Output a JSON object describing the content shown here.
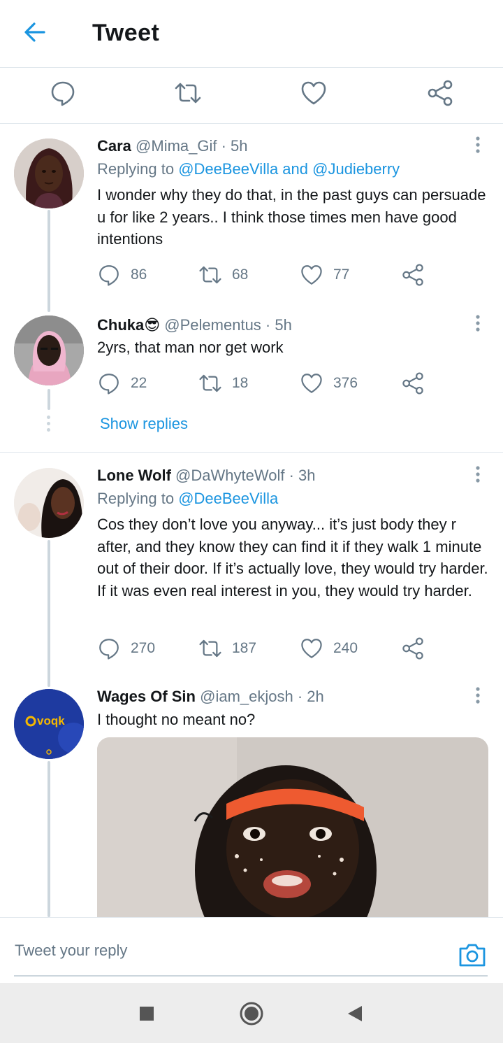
{
  "header": {
    "title": "Tweet"
  },
  "reply_bar": {
    "placeholder": "Tweet your reply"
  },
  "tweets": [
    {
      "name": "Cara",
      "meta": "@Mima_Gif · 5h",
      "replying_prefix": "Replying to ",
      "replying_mentions": "@DeeBeeVilla and @Judieberry",
      "text": "I wonder why they do that, in the past guys can persuade u for like 2 years.. I think those times men have good intentions",
      "replies": "86",
      "retweets": "68",
      "likes": "77"
    },
    {
      "name": "Chuka😎",
      "meta": "@Pelementus · 5h",
      "text": "2yrs, that man nor get work",
      "replies": "22",
      "retweets": "18",
      "likes": "376"
    },
    {
      "name": "Lone Wolf",
      "meta": "@DaWhyteWolf · 3h",
      "replying_prefix": "Replying to ",
      "replying_mentions": "@DeeBeeVilla",
      "text": "Cos they don’t love you anyway... it’s just body they r after, and they know they can find it if they walk 1 minute out of their door. If it’s actually love, they would try harder. If it was even real interest in you, they would try harder.",
      "replies": "270",
      "retweets": "187",
      "likes": "240"
    },
    {
      "name": "Wages Of Sin",
      "meta": "@iam_ekjosh · 2h",
      "text": "I thought no meant no?",
      "avatar_logo": "voqk"
    }
  ],
  "show_replies": "Show replies",
  "colors": {
    "accent": "#1b95e0",
    "muted": "#657786",
    "text": "#14171a",
    "divider": "#e1e8ed"
  },
  "icons": [
    "back-arrow-icon",
    "reply-icon",
    "retweet-icon",
    "like-icon",
    "share-icon",
    "more-vertical-icon",
    "camera-icon"
  ]
}
